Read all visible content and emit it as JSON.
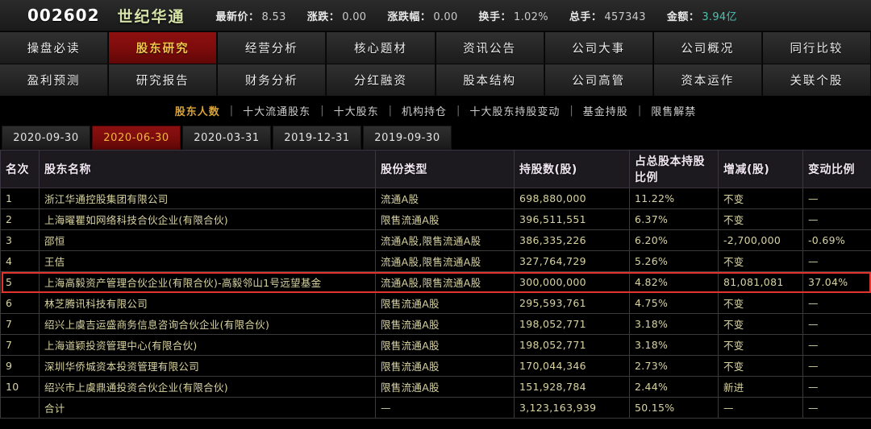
{
  "quote": {
    "code": "002602",
    "name": "世纪华通",
    "fields": [
      {
        "label": "最新价：",
        "value": "8.53",
        "kind": "normal"
      },
      {
        "label": "涨跌：",
        "value": "0.00",
        "kind": "normal"
      },
      {
        "label": "涨跌幅：",
        "value": "0.00",
        "kind": "normal"
      },
      {
        "label": "换手：",
        "value": "1.02%",
        "kind": "normal"
      },
      {
        "label": "总手：",
        "value": "457343",
        "kind": "normal"
      },
      {
        "label": "金额：",
        "value": "3.94亿",
        "kind": "money"
      }
    ]
  },
  "nav": {
    "active": "股东研究",
    "items": [
      "操盘必读",
      "股东研究",
      "经营分析",
      "核心题材",
      "资讯公告",
      "公司大事",
      "公司概况",
      "同行比较",
      "盈利预测",
      "研究报告",
      "财务分析",
      "分红融资",
      "股本结构",
      "公司高管",
      "资本运作",
      "关联个股"
    ]
  },
  "subnav": {
    "active": "股东人数",
    "items": [
      "股东人数",
      "十大流通股东",
      "十大股东",
      "机构持仓",
      "十大股东持股变动",
      "基金持股",
      "限售解禁"
    ],
    "separator": "|"
  },
  "date_tabs": {
    "active": "2020-06-30",
    "items": [
      "2020-09-30",
      "2020-06-30",
      "2020-03-31",
      "2019-12-31",
      "2019-09-30"
    ]
  },
  "table": {
    "headers": [
      "名次",
      "股东名称",
      "股份类型",
      "持股数(股)",
      "占总股本持股比例",
      "增减(股)",
      "变动比例"
    ],
    "rows": [
      {
        "rank": "1",
        "name": "浙江华通控股集团有限公司",
        "type": "流通A股",
        "shares": "698,880,000",
        "pct": "11.22%",
        "delta": "不变",
        "change": "—",
        "highlight": false
      },
      {
        "rank": "2",
        "name": "上海曜瞿如网络科技合伙企业(有限合伙)",
        "type": "限售流通A股",
        "shares": "396,511,551",
        "pct": "6.37%",
        "delta": "不变",
        "change": "—",
        "highlight": false
      },
      {
        "rank": "3",
        "name": "邵恒",
        "type": "流通A股,限售流通A股",
        "shares": "386,335,226",
        "pct": "6.20%",
        "delta": "-2,700,000",
        "change": "-0.69%",
        "highlight": false
      },
      {
        "rank": "4",
        "name": "王佶",
        "type": "流通A股,限售流通A股",
        "shares": "327,764,729",
        "pct": "5.26%",
        "delta": "不变",
        "change": "—",
        "highlight": false
      },
      {
        "rank": "5",
        "name": "上海高毅资产管理合伙企业(有限合伙)-高毅邻山1号远望基金",
        "type": "流通A股,限售流通A股",
        "shares": "300,000,000",
        "pct": "4.82%",
        "delta": "81,081,081",
        "change": "37.04%",
        "highlight": true
      },
      {
        "rank": "6",
        "name": "林芝腾讯科技有限公司",
        "type": "限售流通A股",
        "shares": "295,593,761",
        "pct": "4.75%",
        "delta": "不变",
        "change": "—",
        "highlight": false
      },
      {
        "rank": "7",
        "name": "绍兴上虞吉运盛商务信息咨询合伙企业(有限合伙)",
        "type": "限售流通A股",
        "shares": "198,052,771",
        "pct": "3.18%",
        "delta": "不变",
        "change": "—",
        "highlight": false
      },
      {
        "rank": "7",
        "name": "上海道颖投资管理中心(有限合伙)",
        "type": "限售流通A股",
        "shares": "198,052,771",
        "pct": "3.18%",
        "delta": "不变",
        "change": "—",
        "highlight": false
      },
      {
        "rank": "9",
        "name": "深圳华侨城资本投资管理有限公司",
        "type": "限售流通A股",
        "shares": "170,044,346",
        "pct": "2.73%",
        "delta": "不变",
        "change": "—",
        "highlight": false
      },
      {
        "rank": "10",
        "name": "绍兴市上虞鼎通投资合伙企业(有限合伙)",
        "type": "限售流通A股",
        "shares": "151,928,784",
        "pct": "2.44%",
        "delta": "新进",
        "change": "—",
        "highlight": false
      },
      {
        "rank": "",
        "name": "合计",
        "type": "—",
        "shares": "3,123,163,939",
        "pct": "50.15%",
        "delta": "—",
        "change": "—",
        "highlight": false
      }
    ]
  },
  "colors": {
    "accent_red": "#8e1010",
    "highlight_border": "#e0342c",
    "active_text": "#f5c24a",
    "table_text": "#d8d3a0",
    "stock_name": "#d6e3a8",
    "money_value": "#4fc1b0"
  }
}
